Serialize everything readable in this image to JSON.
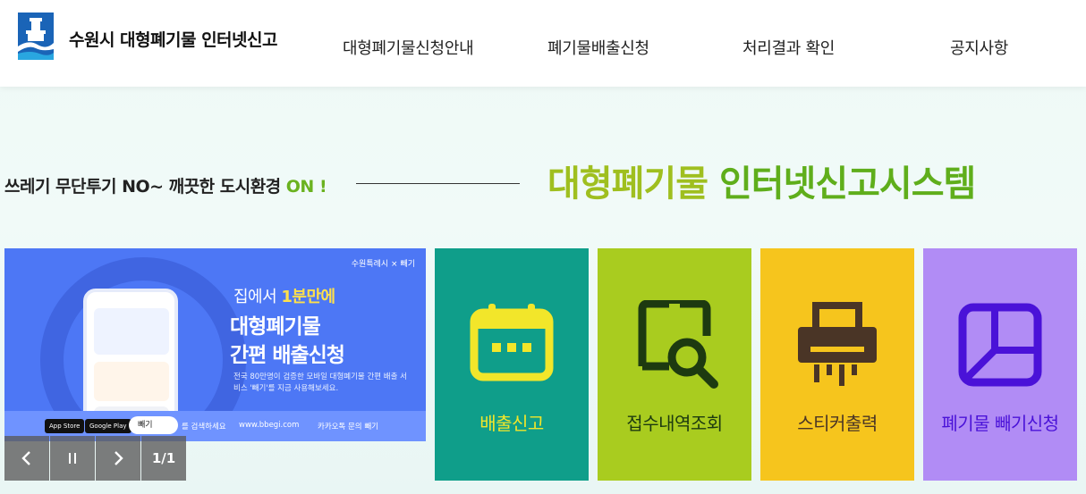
{
  "header": {
    "logo_text": "수원시 대형폐기물 인터넷신고",
    "nav": [
      {
        "label": "대형폐기물신청안내"
      },
      {
        "label": "폐기물배출신청"
      },
      {
        "label": "처리결과 확인"
      },
      {
        "label": "공지사항"
      }
    ]
  },
  "slogan": {
    "left_main": "쓰레기 무단투기 NO~ 깨끗한 도시환경 ",
    "left_accent": "ON !",
    "right_part1": "대형폐기물 ",
    "right_part2": "인터넷신고시스템"
  },
  "banner": {
    "brand": "수원특례시 × 빼기",
    "line1_prefix": "집에서 ",
    "line1_highlight": "1분만에",
    "line2": "대형폐기물",
    "line3": "간편 배출신청",
    "desc": "전국 80만명이 검증한 모바일 대형폐기물 간편 배출 서비스 '빼기'를 지금 사용해보세요.",
    "app_store": "App Store",
    "google_play": "Google Play",
    "search_label": "빼기",
    "search_suffix": "를 검색하세요",
    "website": "www.bbegi.com",
    "kakao": "카카오톡 문의 빼기"
  },
  "controls": {
    "counter": "1/1"
  },
  "tiles": [
    {
      "label": "배출신고",
      "bg": "#0f9e8a",
      "fg": "#f2e62a",
      "icon": "calendar-icon"
    },
    {
      "label": "접수내역조회",
      "bg": "#a9cc1f",
      "fg": "#1d3a10",
      "icon": "device-search-icon"
    },
    {
      "label": "스티커출력",
      "bg": "#f6c51d",
      "fg": "#4a3526",
      "icon": "printer-icon"
    },
    {
      "label": "폐기물 빼기신청",
      "bg": "#b18cf5",
      "fg": "#4a12d8",
      "icon": "layout-icon"
    }
  ]
}
